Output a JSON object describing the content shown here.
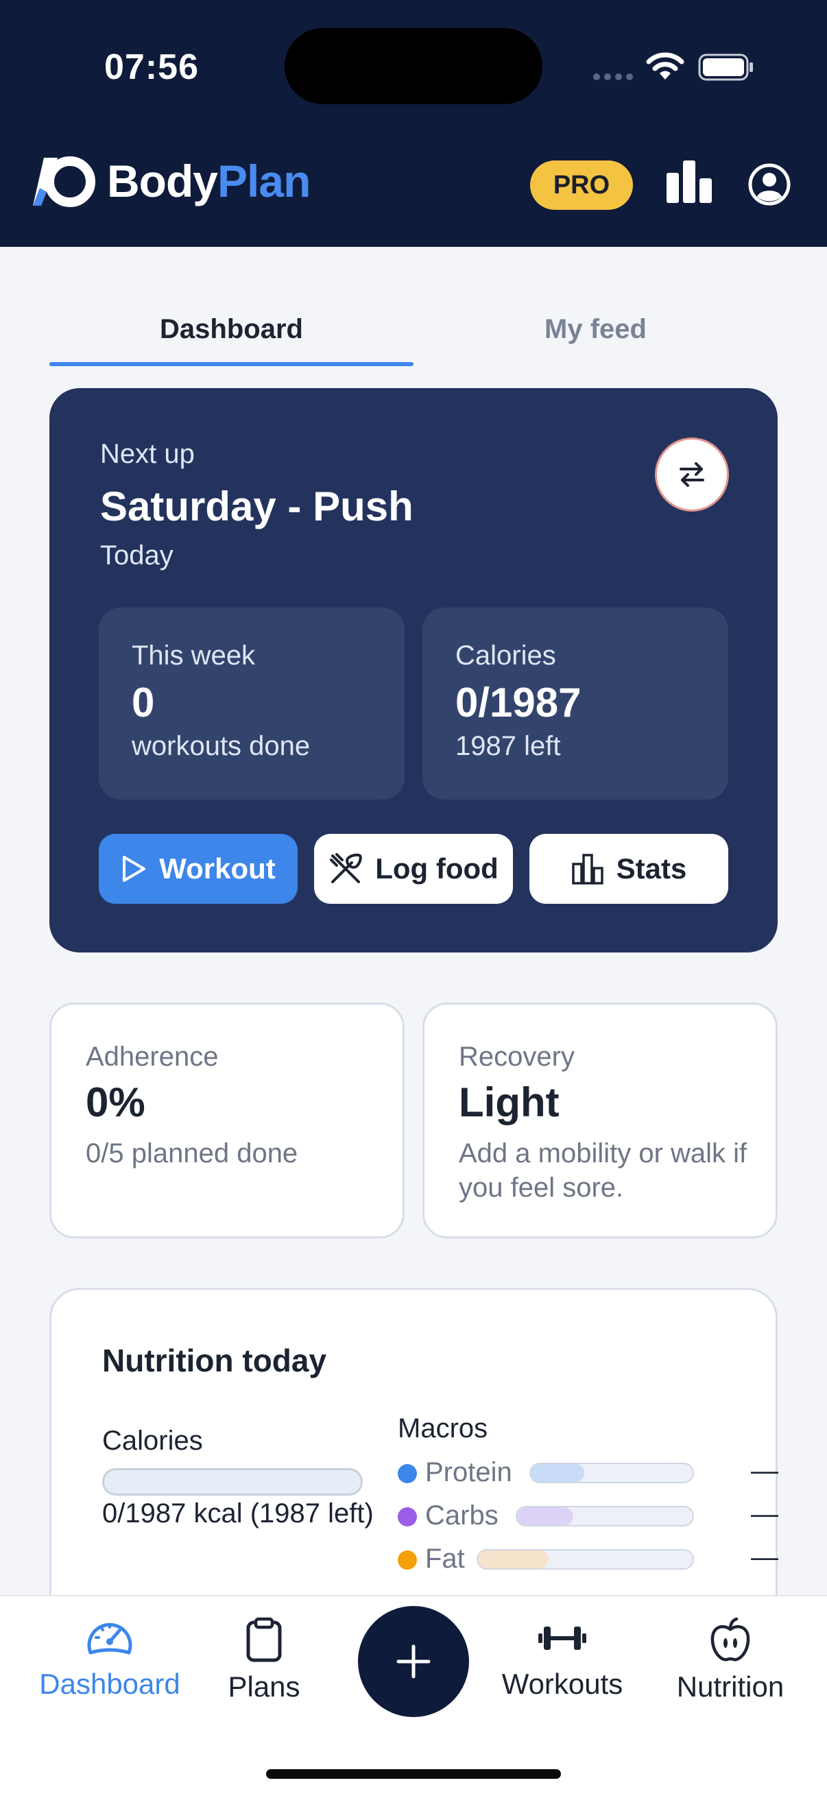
{
  "status_bar": {
    "time": "07:56"
  },
  "header": {
    "brand_prefix": "Body",
    "brand_accent": "Plan",
    "pro_label": "PRO",
    "brand_color": "#0f1b3a",
    "accent_color": "#4a8bf0",
    "pro_color": "#f5c342",
    "icons": [
      "logo-icon",
      "bar-chart-icon",
      "profile-icon"
    ]
  },
  "tabs": [
    {
      "label": "Dashboard",
      "active": true
    },
    {
      "label": "My feed",
      "active": false
    }
  ],
  "hero": {
    "eyebrow": "Next up",
    "title": "Saturday - Push",
    "subtitle": "Today",
    "this_week": {
      "label": "This week",
      "value": "0",
      "caption": "workouts done"
    },
    "calories": {
      "label": "Calories",
      "value": "0/1987",
      "caption": "1987 left"
    },
    "buttons": {
      "workout": "Workout",
      "log_food": "Log food",
      "stats": "Stats"
    }
  },
  "adherence": {
    "label": "Adherence",
    "value": "0%",
    "caption": "0/5 planned done"
  },
  "recovery": {
    "label": "Recovery",
    "value": "Light",
    "caption": "Add a mobility or walk if you feel sore."
  },
  "nutrition": {
    "heading": "Nutrition today",
    "calories_label": "Calories",
    "calories_progress": 0,
    "calories_text": "0/1987 kcal (1987 left)",
    "macros_label": "Macros",
    "macros": [
      {
        "name": "Protein",
        "value": "—",
        "color": "#3d86ea",
        "fill_color": "#c8dbf7",
        "progress": 0.33
      },
      {
        "name": "Carbs",
        "value": "—",
        "color": "#9b5de5",
        "fill_color": "#ddd3f6",
        "progress": 0.32
      },
      {
        "name": "Fat",
        "value": "—",
        "color": "#f59f0b",
        "fill_color": "#f6e3cc",
        "progress": 0.33
      }
    ]
  },
  "bottom_nav": {
    "items": [
      {
        "label": "Dashboard",
        "icon": "speedometer-icon",
        "active": true
      },
      {
        "label": "Plans",
        "icon": "clipboard-icon",
        "active": false
      },
      {
        "label": "Workouts",
        "icon": "dumbbell-icon",
        "active": false
      },
      {
        "label": "Nutrition",
        "icon": "apple-icon",
        "active": false
      }
    ],
    "fab_icon": "plus-icon"
  }
}
